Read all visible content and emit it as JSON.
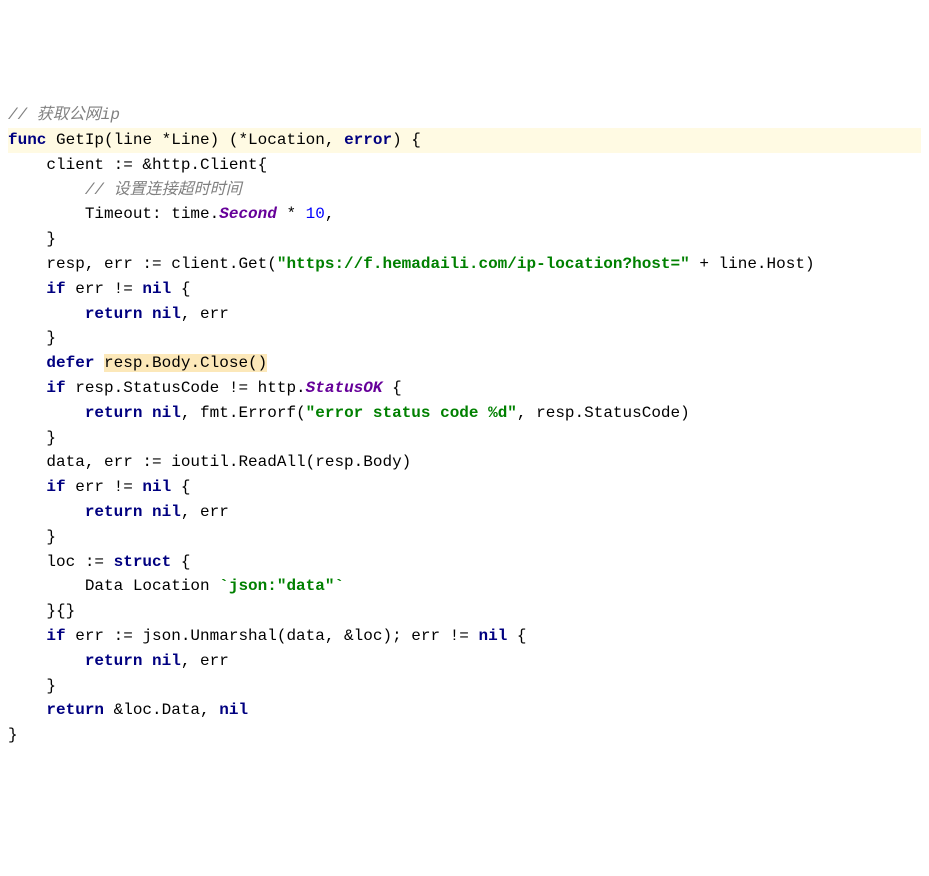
{
  "code": {
    "c1": "// 获取公网ip",
    "kw_func": "func",
    "funcname": "GetIp",
    "sig_open": "(line *Line) (*Location, ",
    "kw_error": "error",
    "sig_close": ") {",
    "l2a": "client := &http.Client{",
    "c2": "// 设置连接超时时间",
    "l3a_label": "Timeout: time.",
    "l3a_second": "Second",
    "l3a_mul": " * ",
    "l3a_num": "10",
    "l3a_end": ",",
    "rbrace": "}",
    "l4a": "resp, err := client.Get(",
    "l4a_str": "\"https://f.hemadaili.com/ip-location?host=\"",
    "l4a_end": " + line.Host)",
    "kw_if": "if",
    "err_chk": " err != ",
    "kw_nil": "nil",
    "obrace": " {",
    "kw_return": "return",
    "ret_nil_err": "nil",
    "comma_err": ", err",
    "kw_defer": "defer",
    "defer_call": "resp.Body.Close()",
    "l_status": " resp.StatusCode != http.",
    "status_ok": "StatusOK",
    "ret_nil2": "nil",
    "fmt_errorf": ", fmt.Errorf(",
    "err_str": "\"error status code %d\"",
    "fmt_end": ", resp.StatusCode)",
    "data_line": "data, err := ioutil.ReadAll(resp.Body)",
    "loc_struct": "loc := ",
    "kw_struct": "struct",
    "data_loc": "Data Location ",
    "json_tag": "`json:\"data\"`",
    "struct_end": "}{}",
    "json_un1": " err := json.Unmarshal(data, &loc); err != ",
    "ret_final": " &loc.Data, ",
    "final_nil": "nil"
  }
}
